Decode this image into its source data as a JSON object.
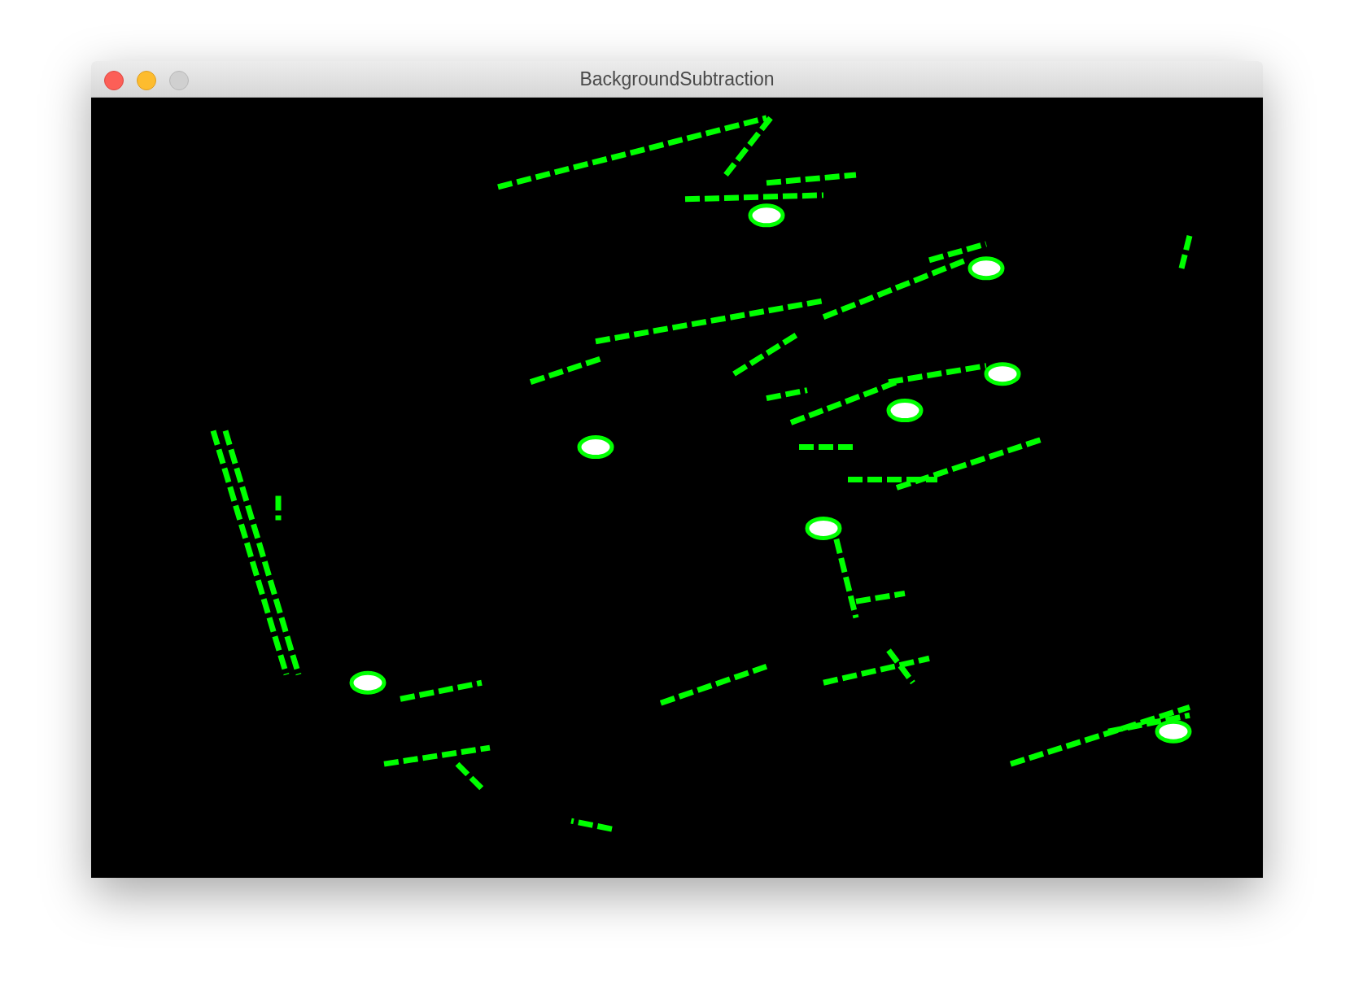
{
  "window": {
    "title": "BackgroundSubtraction"
  }
}
